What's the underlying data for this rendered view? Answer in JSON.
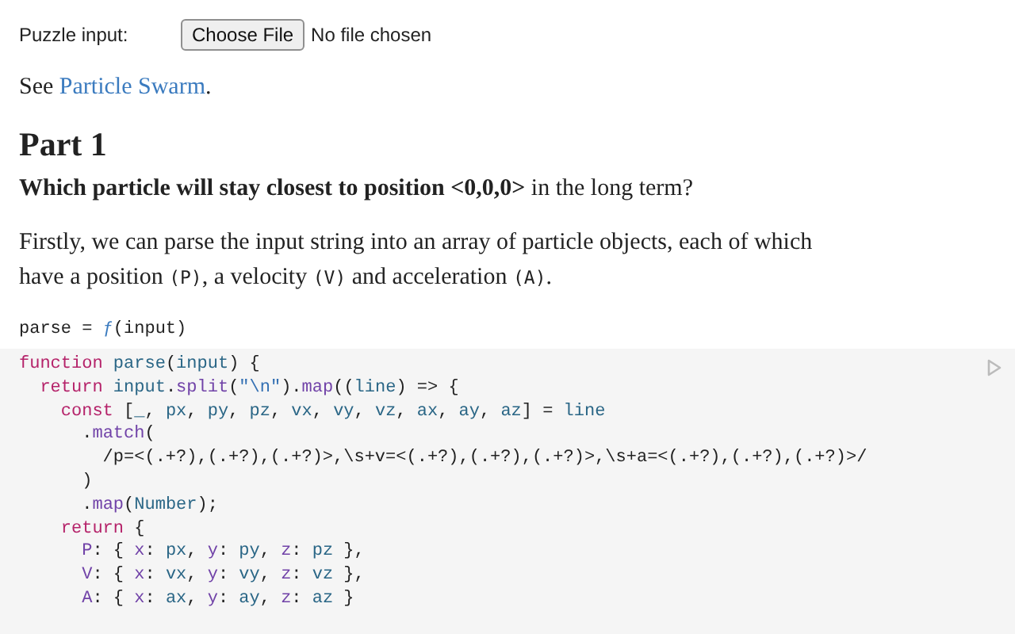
{
  "file_input": {
    "label": "Puzzle input:",
    "button": "Choose File",
    "status": "No file chosen"
  },
  "see": {
    "prefix": "See ",
    "link": "Particle Swarm",
    "suffix": "."
  },
  "heading": "Part 1",
  "question": "**Which particle will stay closest to position <0,0,0>** in the long term?",
  "intro": [
    {
      "text": "Firstly, we can parse the input string into an array of particle objects, each of which have a position ",
      "kind": "text"
    },
    {
      "text": "(P)",
      "kind": "code"
    },
    {
      "text": ", a velocity ",
      "kind": "text"
    },
    {
      "text": "(V)",
      "kind": "code"
    },
    {
      "text": " and acceleration ",
      "kind": "text"
    },
    {
      "text": "(A)",
      "kind": "code"
    },
    {
      "text": ".",
      "kind": "text"
    }
  ],
  "cell_header": {
    "name": "parse = ",
    "fn": "ƒ",
    "args": "(input)"
  },
  "code": [
    [
      {
        "text": "function ",
        "kind": "keyword"
      },
      {
        "text": "parse",
        "kind": "var"
      },
      {
        "text": "(",
        "kind": "plain"
      },
      {
        "text": "input",
        "kind": "var"
      },
      {
        "text": ") {",
        "kind": "plain"
      }
    ],
    [
      {
        "text": "  return ",
        "kind": "keyword"
      },
      {
        "text": "input",
        "kind": "var"
      },
      {
        "text": ".",
        "kind": "plain"
      },
      {
        "text": "split",
        "kind": "prop"
      },
      {
        "text": "(",
        "kind": "plain"
      },
      {
        "text": "\"\\n\"",
        "kind": "string"
      },
      {
        "text": ").",
        "kind": "plain"
      },
      {
        "text": "map",
        "kind": "prop"
      },
      {
        "text": "((",
        "kind": "plain"
      },
      {
        "text": "line",
        "kind": "var"
      },
      {
        "text": ") => {",
        "kind": "plain"
      }
    ],
    [
      {
        "text": "    const",
        "kind": "keyword"
      },
      {
        "text": " [",
        "kind": "plain"
      },
      {
        "text": "_",
        "kind": "var"
      },
      {
        "text": ", ",
        "kind": "plain"
      },
      {
        "text": "px",
        "kind": "var"
      },
      {
        "text": ", ",
        "kind": "plain"
      },
      {
        "text": "py",
        "kind": "var"
      },
      {
        "text": ", ",
        "kind": "plain"
      },
      {
        "text": "pz",
        "kind": "var"
      },
      {
        "text": ", ",
        "kind": "plain"
      },
      {
        "text": "vx",
        "kind": "var"
      },
      {
        "text": ", ",
        "kind": "plain"
      },
      {
        "text": "vy",
        "kind": "var"
      },
      {
        "text": ", ",
        "kind": "plain"
      },
      {
        "text": "vz",
        "kind": "var"
      },
      {
        "text": ", ",
        "kind": "plain"
      },
      {
        "text": "ax",
        "kind": "var"
      },
      {
        "text": ", ",
        "kind": "plain"
      },
      {
        "text": "ay",
        "kind": "var"
      },
      {
        "text": ", ",
        "kind": "plain"
      },
      {
        "text": "az",
        "kind": "var"
      },
      {
        "text": "] = ",
        "kind": "plain"
      },
      {
        "text": "line",
        "kind": "var"
      }
    ],
    [
      {
        "text": "      .",
        "kind": "plain"
      },
      {
        "text": "match",
        "kind": "prop"
      },
      {
        "text": "(",
        "kind": "plain"
      }
    ],
    [
      {
        "text": "        /p=<(.+?),(.+?),(.+?)>,\\s+v=<(.+?),(.+?),(.+?)>,\\s+a=<(.+?),(.+?),(.+?)>/",
        "kind": "plain"
      }
    ],
    [
      {
        "text": "      )",
        "kind": "plain"
      }
    ],
    [
      {
        "text": "      .",
        "kind": "plain"
      },
      {
        "text": "map",
        "kind": "prop"
      },
      {
        "text": "(",
        "kind": "plain"
      },
      {
        "text": "Number",
        "kind": "var"
      },
      {
        "text": ");",
        "kind": "plain"
      }
    ],
    [
      {
        "text": "    return",
        "kind": "keyword"
      },
      {
        "text": " {",
        "kind": "plain"
      }
    ],
    [
      {
        "text": "      P",
        "kind": "prop"
      },
      {
        "text": ": { ",
        "kind": "plain"
      },
      {
        "text": "x",
        "kind": "prop"
      },
      {
        "text": ": ",
        "kind": "plain"
      },
      {
        "text": "px",
        "kind": "var"
      },
      {
        "text": ", ",
        "kind": "plain"
      },
      {
        "text": "y",
        "kind": "prop"
      },
      {
        "text": ": ",
        "kind": "plain"
      },
      {
        "text": "py",
        "kind": "var"
      },
      {
        "text": ", ",
        "kind": "plain"
      },
      {
        "text": "z",
        "kind": "prop"
      },
      {
        "text": ": ",
        "kind": "plain"
      },
      {
        "text": "pz",
        "kind": "var"
      },
      {
        "text": " },",
        "kind": "plain"
      }
    ],
    [
      {
        "text": "      V",
        "kind": "prop"
      },
      {
        "text": ": { ",
        "kind": "plain"
      },
      {
        "text": "x",
        "kind": "prop"
      },
      {
        "text": ": ",
        "kind": "plain"
      },
      {
        "text": "vx",
        "kind": "var"
      },
      {
        "text": ", ",
        "kind": "plain"
      },
      {
        "text": "y",
        "kind": "prop"
      },
      {
        "text": ": ",
        "kind": "plain"
      },
      {
        "text": "vy",
        "kind": "var"
      },
      {
        "text": ", ",
        "kind": "plain"
      },
      {
        "text": "z",
        "kind": "prop"
      },
      {
        "text": ": ",
        "kind": "plain"
      },
      {
        "text": "vz",
        "kind": "var"
      },
      {
        "text": " },",
        "kind": "plain"
      }
    ],
    [
      {
        "text": "      A",
        "kind": "prop"
      },
      {
        "text": ": { ",
        "kind": "plain"
      },
      {
        "text": "x",
        "kind": "prop"
      },
      {
        "text": ": ",
        "kind": "plain"
      },
      {
        "text": "ax",
        "kind": "var"
      },
      {
        "text": ", ",
        "kind": "plain"
      },
      {
        "text": "y",
        "kind": "prop"
      },
      {
        "text": ": ",
        "kind": "plain"
      },
      {
        "text": "ay",
        "kind": "var"
      },
      {
        "text": ", ",
        "kind": "plain"
      },
      {
        "text": "z",
        "kind": "prop"
      },
      {
        "text": ": ",
        "kind": "plain"
      },
      {
        "text": "az",
        "kind": "var"
      },
      {
        "text": " }",
        "kind": "plain"
      }
    ]
  ]
}
